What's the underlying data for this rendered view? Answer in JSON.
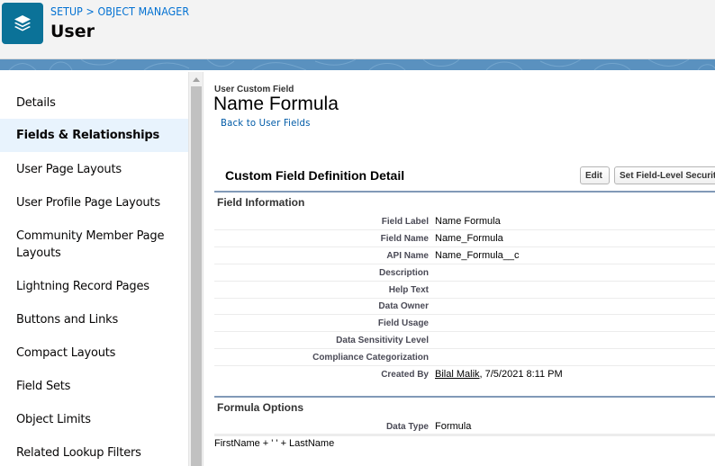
{
  "header": {
    "icon": "layers-icon",
    "breadcrumb": {
      "setup": "SETUP",
      "separator": " > ",
      "object_manager": "OBJECT MANAGER"
    },
    "title": "User"
  },
  "sidebar": {
    "items": [
      {
        "label": "Details",
        "active": false
      },
      {
        "label": "Fields & Relationships",
        "active": true
      },
      {
        "label": "User Page Layouts",
        "active": false
      },
      {
        "label": "User Profile Page Layouts",
        "active": false
      },
      {
        "label": "Community Member Page",
        "label2": "Layouts",
        "active": false
      },
      {
        "label": "Lightning Record Pages",
        "active": false
      },
      {
        "label": "Buttons and Links",
        "active": false
      },
      {
        "label": "Compact Layouts",
        "active": false
      },
      {
        "label": "Field Sets",
        "active": false
      },
      {
        "label": "Object Limits",
        "active": false
      },
      {
        "label": "Related Lookup Filters",
        "active": false
      }
    ]
  },
  "main": {
    "subtitle": "User Custom Field",
    "title": "Name Formula",
    "back_link": "Back to User Fields",
    "section_title": "Custom Field Definition Detail",
    "buttons": {
      "edit": "Edit",
      "set_fls": "Set Field-Level Securit"
    },
    "field_information": {
      "title": "Field Information",
      "rows": [
        {
          "label": "Field Label",
          "value": "Name Formula"
        },
        {
          "label": "Field Name",
          "value": "Name_Formula"
        },
        {
          "label": "API Name",
          "value": "Name_Formula__c"
        },
        {
          "label": "Description",
          "value": ""
        },
        {
          "label": "Help Text",
          "value": ""
        },
        {
          "label": "Data Owner",
          "value": ""
        },
        {
          "label": "Field Usage",
          "value": ""
        },
        {
          "label": "Data Sensitivity Level",
          "value": ""
        },
        {
          "label": "Compliance Categorization",
          "value": ""
        },
        {
          "label": "Created By",
          "value_link": "Bilal Malik",
          "value_rest": ", 7/5/2021 8:11 PM"
        }
      ]
    },
    "formula_options": {
      "title": "Formula Options",
      "rows": [
        {
          "label": "Data Type",
          "value": "Formula"
        }
      ],
      "formula": "FirstName + ' ' + LastName"
    }
  },
  "colors": {
    "icon_bg": "#0b7298",
    "link": "#0070d2",
    "active_item_bg": "#e8f3fd",
    "section_rule": "#8199b7",
    "banner": "#5a91bf"
  }
}
